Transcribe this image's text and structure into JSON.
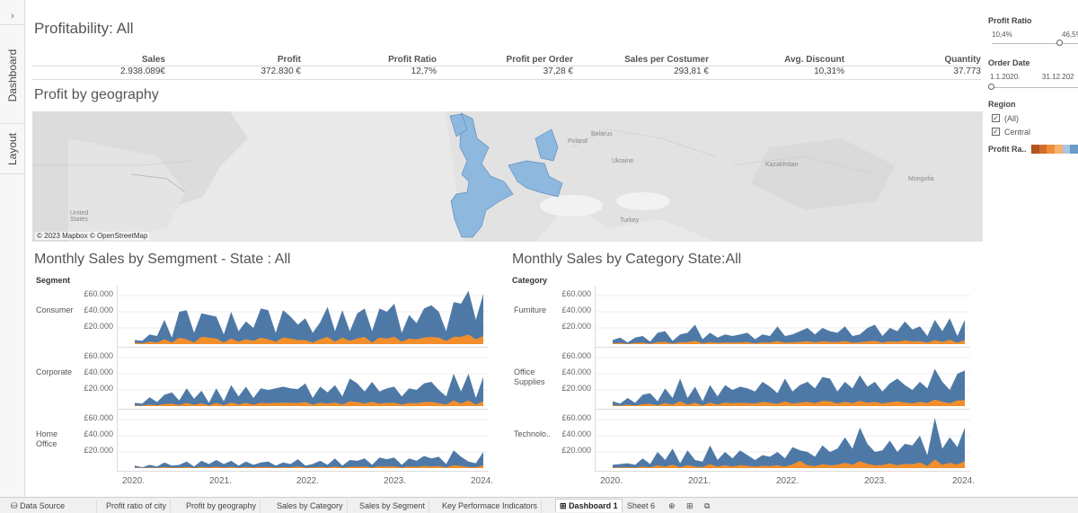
{
  "rail": {
    "collapse": "›",
    "tabs": [
      "Dashboard",
      "Layout"
    ]
  },
  "dashboard": {
    "title": "Profitability: All",
    "kpis": [
      {
        "label": "Sales",
        "value": "2.938.089€"
      },
      {
        "label": "Profit",
        "value": "372.830 €"
      },
      {
        "label": "Profit Ratio",
        "value": "12,7%"
      },
      {
        "label": "Profit per Order",
        "value": "37,28 €"
      },
      {
        "label": "Sales per Costumer",
        "value": "293,81 €"
      },
      {
        "label": "Avg. Discount",
        "value": "10,31%"
      },
      {
        "label": "Quantity",
        "value": "37.773"
      }
    ],
    "map": {
      "title": "Profit by geography",
      "credit": "© 2023 Mapbox © OpenStreetMap",
      "places": [
        "Poland",
        "Belarus",
        "Ukraine",
        "Kazakhstan",
        "Mongolia",
        "Turkey",
        "United States"
      ]
    },
    "segment_chart": {
      "title": "Monthly Sales by Semgment - State : All",
      "header": "Segment",
      "rows": [
        "Consumer",
        "Corporate",
        "Home Office"
      ]
    },
    "category_chart": {
      "title": "Monthly Sales by Category State:All",
      "header": "Category",
      "rows": [
        "Furniture",
        "Office Supplies",
        "Technolo.."
      ]
    },
    "yticks": [
      "£60.000",
      "£40.000",
      "£20.000"
    ],
    "xticks": [
      "2020.",
      "2021.",
      "2022.",
      "2023.",
      "2024."
    ]
  },
  "filters": {
    "profit_ratio": {
      "title": "Profit Ratio",
      "min": "10,4%",
      "max": "46,5%"
    },
    "order_date": {
      "title": "Order Date",
      "from": "1.1.2020.",
      "to": "31.12.202"
    },
    "region": {
      "title": "Region",
      "options": [
        "(All)",
        "Central"
      ],
      "checked": [
        true,
        true
      ]
    },
    "legend": {
      "title": "Profit Ra..",
      "colors": [
        "#b3541e",
        "#d46d2a",
        "#ee8c3c",
        "#f6b26b",
        "#a9c6e2",
        "#6a9bc9"
      ]
    }
  },
  "tabs": [
    {
      "label": "Data Source",
      "icon": "database-icon"
    },
    {
      "label": "Profit ratio of city"
    },
    {
      "label": "Profit by geography"
    },
    {
      "label": "Sales by Category"
    },
    {
      "label": "Sales by Segment"
    },
    {
      "label": "Key Performace Indicators"
    },
    {
      "label": "Dashboard 1",
      "active": true,
      "icon": "grid-icon"
    },
    {
      "label": "Sheet 6"
    }
  ],
  "colors": {
    "blue": "#4e79a7",
    "orange": "#f28e2b",
    "map_blue": "#8fb8de"
  },
  "chart_data": [
    {
      "type": "area",
      "title": "Monthly Sales by Semgment - State : All",
      "x_range": [
        "2020-01",
        "2023-12"
      ],
      "ylim": [
        0,
        70000
      ],
      "series": [
        {
          "name": "Consumer",
          "values": [
            5000,
            4000,
            12000,
            10000,
            30000,
            8000,
            40000,
            42000,
            14000,
            38000,
            36000,
            34000,
            12000,
            40000,
            16000,
            28000,
            20000,
            44000,
            42000,
            14000,
            42000,
            34000,
            24000,
            32000,
            14000,
            27000,
            46000,
            16000,
            42000,
            16000,
            38000,
            44000,
            16000,
            44000,
            40000,
            50000,
            14000,
            36000,
            26000,
            44000,
            48000,
            40000,
            16000,
            52000,
            50000,
            66000,
            30000,
            62000
          ],
          "profit": [
            2000,
            1000,
            3000,
            2000,
            6000,
            2000,
            8000,
            6000,
            2000,
            9000,
            8000,
            7000,
            2000,
            7000,
            3000,
            6000,
            4000,
            8000,
            6000,
            3000,
            8000,
            7000,
            5000,
            5000,
            2000,
            6000,
            9000,
            3000,
            8000,
            4000,
            7000,
            9000,
            2000,
            8000,
            7000,
            9000,
            3000,
            7000,
            6000,
            8000,
            9000,
            8000,
            4000,
            9000,
            9000,
            12000,
            6000,
            10000
          ]
        },
        {
          "name": "Corporate",
          "values": [
            4000,
            3000,
            11000,
            5000,
            14000,
            17000,
            7000,
            22000,
            9000,
            19000,
            4000,
            22000,
            6000,
            26000,
            12000,
            24000,
            10000,
            22000,
            20000,
            22000,
            24000,
            22000,
            21000,
            28000,
            10000,
            24000,
            17000,
            26000,
            12000,
            34000,
            28000,
            18000,
            30000,
            18000,
            22000,
            24000,
            12000,
            22000,
            20000,
            28000,
            30000,
            20000,
            12000,
            40000,
            18000,
            40000,
            10000,
            36000
          ],
          "profit": [
            800,
            600,
            2000,
            1000,
            2500,
            3000,
            1200,
            4000,
            1500,
            3500,
            800,
            4000,
            1000,
            4500,
            2000,
            4000,
            1800,
            4000,
            3500,
            4000,
            4200,
            4000,
            3800,
            5000,
            1800,
            4200,
            3000,
            4500,
            2000,
            6000,
            5000,
            3200,
            5200,
            3200,
            4000,
            4200,
            2000,
            4000,
            3500,
            5000,
            5200,
            3500,
            2000,
            7000,
            3200,
            7000,
            1800,
            6000
          ]
        },
        {
          "name": "Home Office",
          "values": [
            3000,
            1000,
            4000,
            2000,
            7000,
            3000,
            4000,
            8000,
            2000,
            9000,
            5000,
            10000,
            5000,
            9000,
            3000,
            8000,
            4000,
            7000,
            8000,
            3000,
            7000,
            5000,
            11000,
            3000,
            5000,
            9000,
            4000,
            12000,
            3000,
            10000,
            9000,
            12000,
            4000,
            13000,
            11000,
            13000,
            4000,
            12000,
            9000,
            15000,
            12000,
            14000,
            5000,
            22000,
            14000,
            8000,
            6000,
            20000
          ],
          "profit": [
            500,
            200,
            700,
            400,
            1200,
            500,
            700,
            1400,
            300,
            1500,
            900,
            1700,
            900,
            1500,
            500,
            1400,
            700,
            1200,
            1400,
            500,
            1200,
            900,
            1900,
            500,
            900,
            1500,
            700,
            2000,
            500,
            1700,
            1500,
            2000,
            700,
            2200,
            1900,
            2200,
            700,
            2000,
            1500,
            2500,
            2000,
            2400,
            900,
            3700,
            2400,
            1400,
            1000,
            3400
          ]
        }
      ],
      "profit_series_color": "orange",
      "sales_series_color": "blue"
    },
    {
      "type": "area",
      "title": "Monthly Sales by Category State:All",
      "x_range": [
        "2020-01",
        "2023-12"
      ],
      "ylim": [
        0,
        70000
      ],
      "series": [
        {
          "name": "Furniture",
          "values": [
            5000,
            8000,
            2000,
            8000,
            10000,
            3000,
            14000,
            16000,
            4000,
            12000,
            14000,
            24000,
            6000,
            14000,
            8000,
            12000,
            10000,
            12000,
            14000,
            6000,
            12000,
            10000,
            22000,
            10000,
            12000,
            16000,
            20000,
            12000,
            20000,
            16000,
            14000,
            22000,
            10000,
            12000,
            20000,
            24000,
            10000,
            20000,
            16000,
            28000,
            18000,
            22000,
            10000,
            30000,
            16000,
            32000,
            10000,
            30000
          ],
          "profit": [
            1000,
            1500,
            400,
            1500,
            2000,
            600,
            2500,
            2800,
            800,
            2200,
            2500,
            4000,
            1000,
            2500,
            1500,
            2200,
            1800,
            2200,
            2500,
            1000,
            2200,
            1800,
            3800,
            1800,
            2200,
            2800,
            3500,
            2200,
            3500,
            2800,
            2500,
            3800,
            1800,
            2200,
            3500,
            4000,
            1800,
            3500,
            2800,
            4800,
            3200,
            3800,
            1800,
            5000,
            2800,
            5200,
            1800,
            5000
          ]
        },
        {
          "name": "Office Supplies",
          "values": [
            6000,
            3000,
            10000,
            4000,
            14000,
            16000,
            6000,
            22000,
            10000,
            34000,
            10000,
            24000,
            6000,
            26000,
            12000,
            26000,
            20000,
            24000,
            22000,
            18000,
            30000,
            24000,
            16000,
            34000,
            18000,
            26000,
            30000,
            22000,
            36000,
            34000,
            18000,
            30000,
            22000,
            38000,
            24000,
            30000,
            18000,
            28000,
            34000,
            26000,
            20000,
            30000,
            22000,
            46000,
            30000,
            20000,
            40000,
            44000
          ],
          "profit": [
            1000,
            500,
            1800,
            700,
            2500,
            2800,
            1000,
            3800,
            1800,
            6000,
            1800,
            4200,
            1000,
            4500,
            2000,
            4500,
            3500,
            4200,
            3800,
            3200,
            5200,
            4200,
            2800,
            6000,
            3200,
            4500,
            5200,
            3800,
            6200,
            6000,
            3200,
            5200,
            3800,
            6500,
            4200,
            5200,
            3200,
            4800,
            6000,
            4500,
            3500,
            5200,
            3800,
            8000,
            5200,
            3500,
            7000,
            7600
          ]
        },
        {
          "name": "Technolo..",
          "values": [
            4000,
            5000,
            6000,
            4000,
            12000,
            5000,
            20000,
            10000,
            24000,
            6000,
            22000,
            10000,
            8000,
            28000,
            10000,
            20000,
            12000,
            22000,
            16000,
            10000,
            16000,
            14000,
            20000,
            12000,
            26000,
            22000,
            20000,
            14000,
            28000,
            20000,
            24000,
            38000,
            24000,
            50000,
            30000,
            20000,
            22000,
            34000,
            20000,
            30000,
            28000,
            40000,
            16000,
            62000,
            24000,
            38000,
            26000,
            50000
          ],
          "profit": [
            600,
            800,
            1000,
            600,
            2000,
            800,
            3500,
            1800,
            4200,
            1000,
            3800,
            1800,
            1200,
            4800,
            1800,
            3500,
            2000,
            3800,
            2800,
            1800,
            2800,
            2400,
            3500,
            2000,
            4500,
            9000,
            3500,
            2400,
            4800,
            3500,
            4200,
            6500,
            4200,
            8500,
            5200,
            3500,
            3800,
            5800,
            3500,
            5200,
            4800,
            7000,
            2800,
            10500,
            4200,
            6500,
            4500,
            8500
          ]
        }
      ],
      "profit_series_color": "orange",
      "sales_series_color": "blue"
    }
  ]
}
